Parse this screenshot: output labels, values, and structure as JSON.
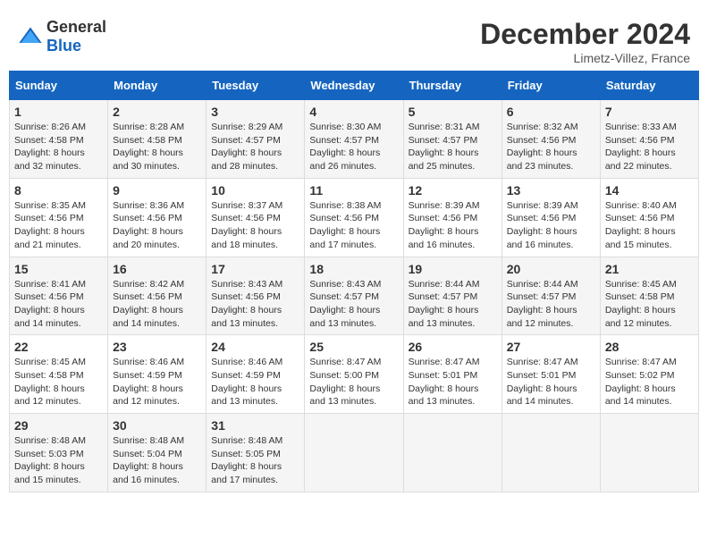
{
  "header": {
    "logo_general": "General",
    "logo_blue": "Blue",
    "month_title": "December 2024",
    "subtitle": "Limetz-Villez, France"
  },
  "weekdays": [
    "Sunday",
    "Monday",
    "Tuesday",
    "Wednesday",
    "Thursday",
    "Friday",
    "Saturday"
  ],
  "weeks": [
    [
      {
        "day": "1",
        "sunrise": "8:26 AM",
        "sunset": "4:58 PM",
        "daylight": "8 hours and 32 minutes."
      },
      {
        "day": "2",
        "sunrise": "8:28 AM",
        "sunset": "4:58 PM",
        "daylight": "8 hours and 30 minutes."
      },
      {
        "day": "3",
        "sunrise": "8:29 AM",
        "sunset": "4:57 PM",
        "daylight": "8 hours and 28 minutes."
      },
      {
        "day": "4",
        "sunrise": "8:30 AM",
        "sunset": "4:57 PM",
        "daylight": "8 hours and 26 minutes."
      },
      {
        "day": "5",
        "sunrise": "8:31 AM",
        "sunset": "4:57 PM",
        "daylight": "8 hours and 25 minutes."
      },
      {
        "day": "6",
        "sunrise": "8:32 AM",
        "sunset": "4:56 PM",
        "daylight": "8 hours and 23 minutes."
      },
      {
        "day": "7",
        "sunrise": "8:33 AM",
        "sunset": "4:56 PM",
        "daylight": "8 hours and 22 minutes."
      }
    ],
    [
      {
        "day": "8",
        "sunrise": "8:35 AM",
        "sunset": "4:56 PM",
        "daylight": "8 hours and 21 minutes."
      },
      {
        "day": "9",
        "sunrise": "8:36 AM",
        "sunset": "4:56 PM",
        "daylight": "8 hours and 20 minutes."
      },
      {
        "day": "10",
        "sunrise": "8:37 AM",
        "sunset": "4:56 PM",
        "daylight": "8 hours and 18 minutes."
      },
      {
        "day": "11",
        "sunrise": "8:38 AM",
        "sunset": "4:56 PM",
        "daylight": "8 hours and 17 minutes."
      },
      {
        "day": "12",
        "sunrise": "8:39 AM",
        "sunset": "4:56 PM",
        "daylight": "8 hours and 16 minutes."
      },
      {
        "day": "13",
        "sunrise": "8:39 AM",
        "sunset": "4:56 PM",
        "daylight": "8 hours and 16 minutes."
      },
      {
        "day": "14",
        "sunrise": "8:40 AM",
        "sunset": "4:56 PM",
        "daylight": "8 hours and 15 minutes."
      }
    ],
    [
      {
        "day": "15",
        "sunrise": "8:41 AM",
        "sunset": "4:56 PM",
        "daylight": "8 hours and 14 minutes."
      },
      {
        "day": "16",
        "sunrise": "8:42 AM",
        "sunset": "4:56 PM",
        "daylight": "8 hours and 14 minutes."
      },
      {
        "day": "17",
        "sunrise": "8:43 AM",
        "sunset": "4:56 PM",
        "daylight": "8 hours and 13 minutes."
      },
      {
        "day": "18",
        "sunrise": "8:43 AM",
        "sunset": "4:57 PM",
        "daylight": "8 hours and 13 minutes."
      },
      {
        "day": "19",
        "sunrise": "8:44 AM",
        "sunset": "4:57 PM",
        "daylight": "8 hours and 13 minutes."
      },
      {
        "day": "20",
        "sunrise": "8:44 AM",
        "sunset": "4:57 PM",
        "daylight": "8 hours and 12 minutes."
      },
      {
        "day": "21",
        "sunrise": "8:45 AM",
        "sunset": "4:58 PM",
        "daylight": "8 hours and 12 minutes."
      }
    ],
    [
      {
        "day": "22",
        "sunrise": "8:45 AM",
        "sunset": "4:58 PM",
        "daylight": "8 hours and 12 minutes."
      },
      {
        "day": "23",
        "sunrise": "8:46 AM",
        "sunset": "4:59 PM",
        "daylight": "8 hours and 12 minutes."
      },
      {
        "day": "24",
        "sunrise": "8:46 AM",
        "sunset": "4:59 PM",
        "daylight": "8 hours and 13 minutes."
      },
      {
        "day": "25",
        "sunrise": "8:47 AM",
        "sunset": "5:00 PM",
        "daylight": "8 hours and 13 minutes."
      },
      {
        "day": "26",
        "sunrise": "8:47 AM",
        "sunset": "5:01 PM",
        "daylight": "8 hours and 13 minutes."
      },
      {
        "day": "27",
        "sunrise": "8:47 AM",
        "sunset": "5:01 PM",
        "daylight": "8 hours and 14 minutes."
      },
      {
        "day": "28",
        "sunrise": "8:47 AM",
        "sunset": "5:02 PM",
        "daylight": "8 hours and 14 minutes."
      }
    ],
    [
      {
        "day": "29",
        "sunrise": "8:48 AM",
        "sunset": "5:03 PM",
        "daylight": "8 hours and 15 minutes."
      },
      {
        "day": "30",
        "sunrise": "8:48 AM",
        "sunset": "5:04 PM",
        "daylight": "8 hours and 16 minutes."
      },
      {
        "day": "31",
        "sunrise": "8:48 AM",
        "sunset": "5:05 PM",
        "daylight": "8 hours and 17 minutes."
      },
      null,
      null,
      null,
      null
    ]
  ],
  "labels": {
    "sunrise": "Sunrise:",
    "sunset": "Sunset:",
    "daylight": "Daylight:"
  }
}
